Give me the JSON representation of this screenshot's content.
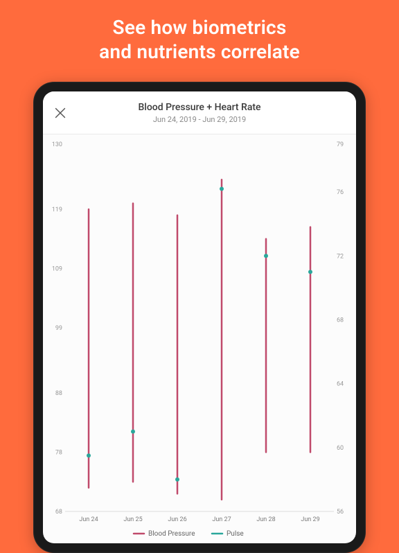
{
  "headline_l1": "See how biometrics",
  "headline_l2": "and nutrients correlate",
  "header": {
    "title": "Blood Pressure + Heart Rate",
    "subtitle": "Jun 24, 2019 - Jun 29, 2019",
    "close_icon": "close"
  },
  "legend": {
    "bp": "Blood Pressure",
    "pulse": "Pulse"
  },
  "chart_data": {
    "type": "range-bar+scatter",
    "title": "Blood Pressure + Heart Rate",
    "subtitle": "Jun 24, 2019 - Jun 29, 2019",
    "x_categories": [
      "Jun 24",
      "Jun 25",
      "Jun 26",
      "Jun 27",
      "Jun 28",
      "Jun 29"
    ],
    "y_left": {
      "label": "Blood Pressure",
      "ticks": [
        68,
        78,
        88,
        99,
        109,
        119,
        130
      ],
      "range": [
        68,
        130
      ],
      "color": "#c04a6b"
    },
    "y_right": {
      "label": "Pulse",
      "ticks": [
        56,
        60,
        64,
        68,
        72,
        76,
        79
      ],
      "range": [
        56,
        79
      ],
      "color": "#2aa79b"
    },
    "series": [
      {
        "name": "Blood Pressure",
        "axis": "left",
        "type": "range-bar",
        "data": [
          {
            "x": "Jun 24",
            "low": 72,
            "high": 119
          },
          {
            "x": "Jun 25",
            "low": 73,
            "high": 120
          },
          {
            "x": "Jun 26",
            "low": 71,
            "high": 118
          },
          {
            "x": "Jun 27",
            "low": 70,
            "high": 124
          },
          {
            "x": "Jun 28",
            "low": 78,
            "high": 114
          },
          {
            "x": "Jun 29",
            "low": 78,
            "high": 116
          }
        ]
      },
      {
        "name": "Pulse",
        "axis": "right",
        "type": "scatter",
        "data": [
          {
            "x": "Jun 24",
            "y": 59.5
          },
          {
            "x": "Jun 25",
            "y": 61
          },
          {
            "x": "Jun 26",
            "y": 58
          },
          {
            "x": "Jun 27",
            "y": 76.2
          },
          {
            "x": "Jun 28",
            "y": 72
          },
          {
            "x": "Jun 29",
            "y": 71
          }
        ]
      }
    ]
  }
}
